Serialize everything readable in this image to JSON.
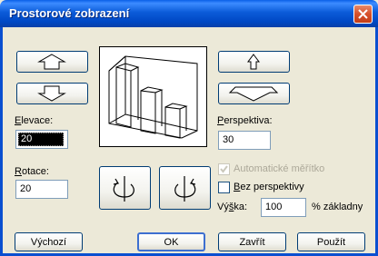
{
  "window": {
    "title": "Prostorové zobrazení"
  },
  "labels": {
    "elevation": "Elevace:",
    "rotation": "Rotace:",
    "perspective": "Perspektiva:",
    "auto_scale": "Automatické měřítko",
    "no_perspective": "Bez perspektivy",
    "height": "Výška:",
    "height_suffix": "% základny"
  },
  "fields": {
    "elevation": "20",
    "rotation": "20",
    "perspective": "30",
    "height": "100"
  },
  "checkboxes": {
    "auto_scale": true,
    "auto_scale_disabled": true,
    "no_perspective": false
  },
  "buttons": {
    "default": "Výchozí",
    "ok": "OK",
    "close": "Zavřít",
    "apply": "Použít"
  }
}
